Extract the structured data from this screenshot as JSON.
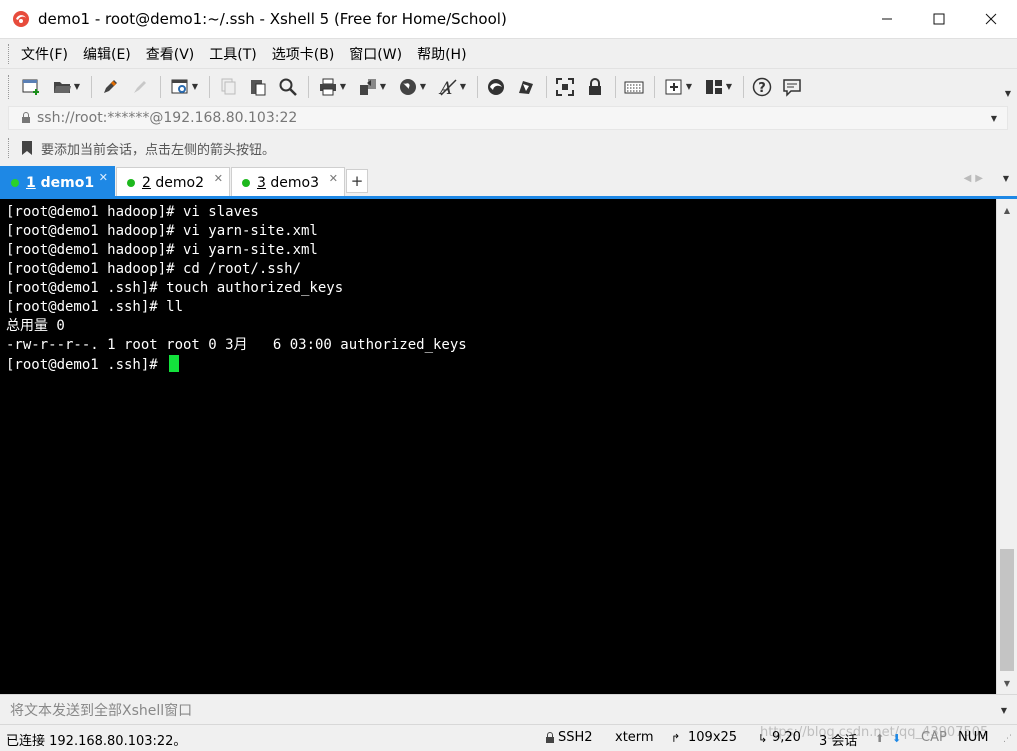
{
  "window": {
    "title": "demo1 - root@demo1:~/.ssh - Xshell 5 (Free for Home/School)",
    "controls": {
      "minimize": "—",
      "maximize": "☐",
      "close": "✕"
    }
  },
  "menu": {
    "items": [
      "文件(F)",
      "编辑(E)",
      "查看(V)",
      "工具(T)",
      "选项卡(B)",
      "窗口(W)",
      "帮助(H)"
    ]
  },
  "address": {
    "value": "ssh://root:******@192.168.80.103:22"
  },
  "hint": {
    "text": "要添加当前会话，点击左侧的箭头按钮。"
  },
  "tabs": [
    {
      "num": "1",
      "name": "demo1",
      "active": true
    },
    {
      "num": "2",
      "name": "demo2",
      "active": false
    },
    {
      "num": "3",
      "name": "demo3",
      "active": false
    }
  ],
  "terminal": {
    "lines": [
      "[root@demo1 hadoop]# vi slaves",
      "[root@demo1 hadoop]# vi yarn-site.xml",
      "[root@demo1 hadoop]# vi yarn-site.xml",
      "[root@demo1 hadoop]# cd /root/.ssh/",
      "[root@demo1 .ssh]# touch authorized_keys",
      "[root@demo1 .ssh]# ll",
      "总用量 0",
      "-rw-r--r--. 1 root root 0 3月   6 03:00 authorized_keys"
    ],
    "prompt": "[root@demo1 .ssh]# "
  },
  "sendbar": {
    "placeholder": "将文本发送到全部Xshell窗口"
  },
  "status": {
    "connection": "已连接 192.168.80.103:22。",
    "protocol": "SSH2",
    "term": "xterm",
    "size": "109x25",
    "position": "9,20",
    "sessions": "3 会话",
    "caps": "CAP",
    "num": "NUM",
    "watermark": "https://blog.csdn.net/qq_43907505"
  },
  "colors": {
    "accent": "#1e88e5",
    "tab_dot": "#1db81d",
    "cursor": "#13e23c",
    "terminal_bg": "#000000"
  }
}
